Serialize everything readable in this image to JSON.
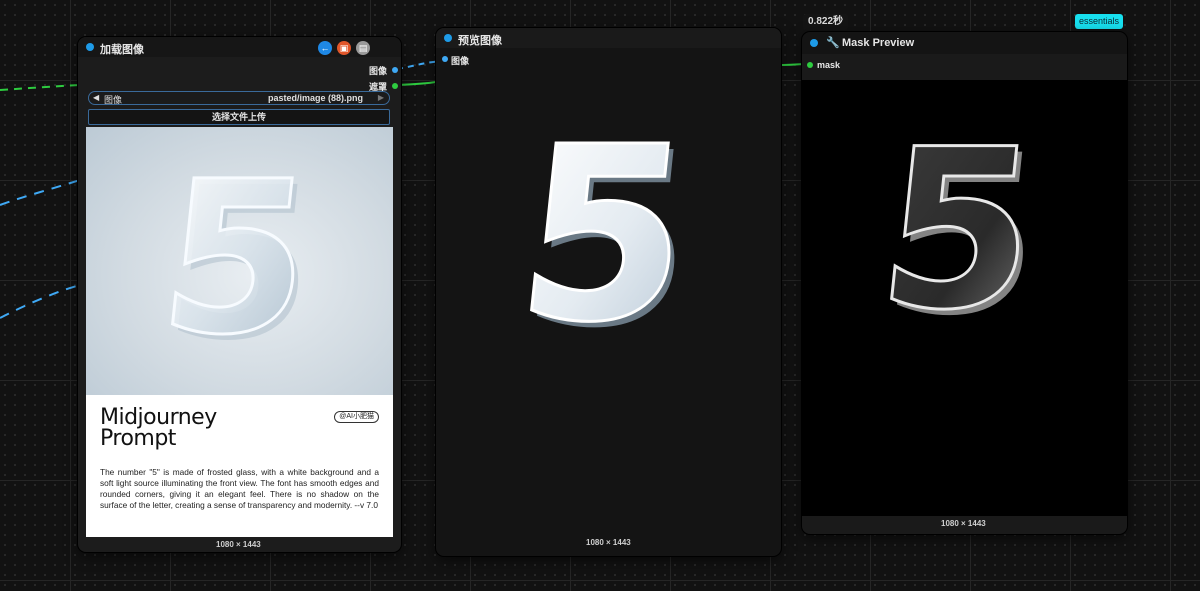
{
  "canvas": {
    "execution_time": "0.822秒",
    "essentials_badge": "essentials"
  },
  "load_image_node": {
    "title": "加载图像",
    "header_icons": [
      "back-arrow-icon",
      "pin-icon",
      "clipboard-icon"
    ],
    "outputs": [
      {
        "label": "图像",
        "color": "#3fa9f5"
      },
      {
        "label": "遮罩",
        "color": "#2ecc40"
      }
    ],
    "image_widget": {
      "label": "图像",
      "value": "pasted/image (88).png"
    },
    "upload_button": "选择文件上传",
    "card": {
      "glyph": "5",
      "title_line1": "Midjourney",
      "title_line2": "Prompt",
      "badge": "@AI小肥猫",
      "description": "The number \"5\" is made of frosted glass, with a white background and a soft light source illuminating the front view. The font has smooth edges and rounded corners, giving it an elegant feel. There is no shadow on the surface of the letter, creating a sense of transparency and modernity. --v 7.0"
    },
    "image_size": "1080 × 1443"
  },
  "preview_node": {
    "title": "预览图像",
    "input_label": "图像",
    "glyph": "5",
    "image_size": "1080 × 1443"
  },
  "mask_node": {
    "title": "Mask Preview",
    "title_icon": "wrench-icon",
    "input_label": "mask",
    "glyph": "5",
    "image_size": "1080 × 1443"
  },
  "colors": {
    "accent_blue": "#1e9be8",
    "image_link": "#3fa9f5",
    "mask_link": "#2ecc40",
    "essentials": "#17e0ef"
  }
}
